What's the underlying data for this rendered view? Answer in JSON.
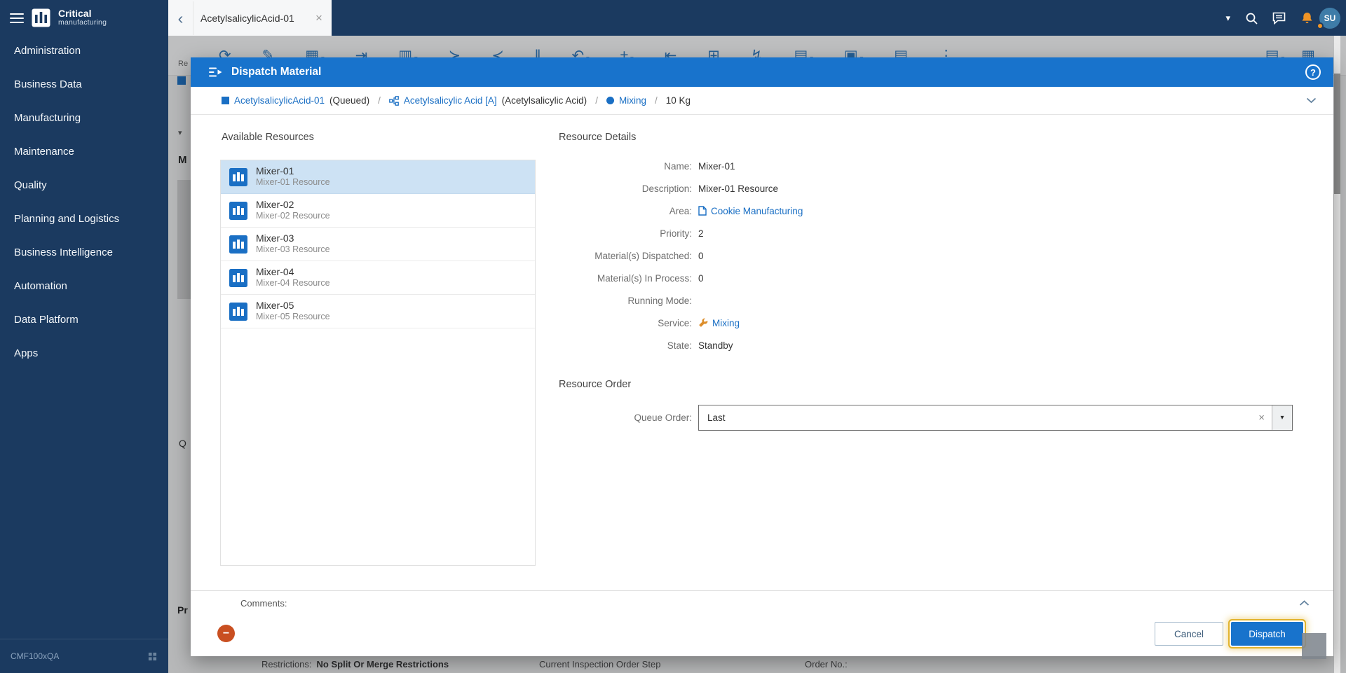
{
  "brand": {
    "name": "Critical",
    "subname": "manufacturing",
    "environment": "CMF100xQA"
  },
  "icons": {
    "back": "‹",
    "close": "×",
    "caret": "▾",
    "clear": "×",
    "minus": "−",
    "help": "?"
  },
  "topbar": {
    "tab_label": "AcetylsalicylicAcid-01",
    "avatar_initials": "SU"
  },
  "sidebar": {
    "items": [
      {
        "label": "Administration"
      },
      {
        "label": "Business Data"
      },
      {
        "label": "Manufacturing"
      },
      {
        "label": "Maintenance"
      },
      {
        "label": "Quality"
      },
      {
        "label": "Planning and Logistics"
      },
      {
        "label": "Business Intelligence"
      },
      {
        "label": "Automation"
      },
      {
        "label": "Data Platform"
      },
      {
        "label": "Apps"
      }
    ]
  },
  "toolbar": {
    "icons": [
      {
        "name": "refresh-icon",
        "glyph": "⟳"
      },
      {
        "name": "edit-icon",
        "glyph": "✎"
      },
      {
        "name": "views-icon",
        "glyph": "▦"
      },
      {
        "name": "track-in-icon",
        "glyph": "⇥"
      },
      {
        "name": "split-view-icon",
        "glyph": "▥"
      },
      {
        "name": "split-icon",
        "glyph": "≻"
      },
      {
        "name": "merge-icon",
        "glyph": "≺"
      },
      {
        "name": "hold-icon",
        "glyph": "‖"
      },
      {
        "name": "undo-icon",
        "glyph": "↶"
      },
      {
        "name": "adjust-icon",
        "glyph": "±"
      },
      {
        "name": "move-icon",
        "glyph": "⇤"
      },
      {
        "name": "change-equipment-icon",
        "glyph": "⊞"
      },
      {
        "name": "actions-icon",
        "glyph": "↯"
      },
      {
        "name": "documents-icon",
        "glyph": "▤"
      },
      {
        "name": "print-icon",
        "glyph": "▣"
      },
      {
        "name": "report-icon",
        "glyph": "▤"
      },
      {
        "name": "more-icon",
        "glyph": "⋮"
      }
    ],
    "right_icons": [
      {
        "name": "panel-icon",
        "glyph": "▤"
      },
      {
        "name": "grid-icon",
        "glyph": "▦"
      }
    ],
    "partial_label": "Re"
  },
  "background": {
    "fragments": {
      "panel_m": "M",
      "panel_q": "Q",
      "panel_pr": "Pr"
    },
    "footer_row": {
      "restrictions_label": "Restrictions:",
      "restrictions_value": "No Split Or Merge Restrictions",
      "inspection_label": "Current Inspection Order Step",
      "order_no_label": "Order No.:"
    }
  },
  "dialog": {
    "title": "Dispatch Material",
    "context": {
      "material_name": "AcetylsalicylicAcid-01",
      "material_state": "(Queued)",
      "separator": "/",
      "product_name": "Acetylsalicylic Acid [A]",
      "product_description": "(Acetylsalicylic Acid)",
      "step_name": "Mixing",
      "quantity": "10 Kg"
    },
    "resources": {
      "title": "Available Resources",
      "items": [
        {
          "name": "Mixer-01",
          "description": "Mixer-01 Resource"
        },
        {
          "name": "Mixer-02",
          "description": "Mixer-02 Resource"
        },
        {
          "name": "Mixer-03",
          "description": "Mixer-03 Resource"
        },
        {
          "name": "Mixer-04",
          "description": "Mixer-04 Resource"
        },
        {
          "name": "Mixer-05",
          "description": "Mixer-05 Resource"
        }
      ]
    },
    "details": {
      "title": "Resource Details",
      "fields": [
        {
          "label": "Name:",
          "value": "Mixer-01"
        },
        {
          "label": "Description:",
          "value": "Mixer-01 Resource"
        },
        {
          "label": "Area:",
          "value": "Cookie Manufacturing"
        },
        {
          "label": "Priority:",
          "value": "2"
        },
        {
          "label": "Material(s) Dispatched:",
          "value": "0"
        },
        {
          "label": "Material(s) In Process:",
          "value": "0"
        },
        {
          "label": "Running Mode:",
          "value": ""
        },
        {
          "label": "Service:",
          "value": "Mixing"
        },
        {
          "label": "State:",
          "value": "Standby"
        }
      ]
    },
    "resource_order": {
      "title": "Resource Order",
      "queue_label": "Queue Order:",
      "queue_value": "Last"
    },
    "comments_label": "Comments:",
    "actions": {
      "cancel": "Cancel",
      "dispatch": "Dispatch"
    }
  },
  "colors": {
    "accent_blue": "#1a6fc4",
    "header_blue": "#1873cc",
    "sidebar_navy": "#1b3a60",
    "selected_row": "#cde2f4",
    "focus_ring": "#e2b32c",
    "alert_orange": "#ef9426",
    "remove_red": "#c94f21"
  }
}
